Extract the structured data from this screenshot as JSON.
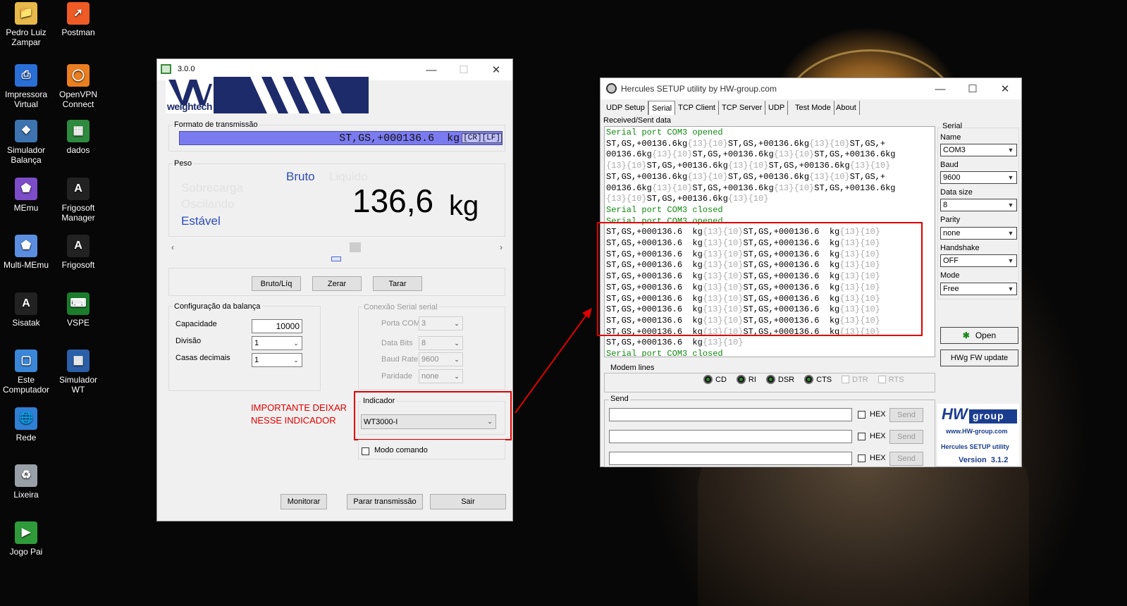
{
  "desktop": {
    "icons": [
      {
        "label": "Pedro Luiz Zampar",
        "icon": "folder-user-icon",
        "color": "#e8b84a"
      },
      {
        "label": "Postman",
        "icon": "postman-icon",
        "color": "#ef5b25"
      },
      {
        "label": "Impressora Virtual",
        "icon": "printer-icon",
        "color": "#2a6fd6"
      },
      {
        "label": "OpenVPN Connect",
        "icon": "openvpn-icon",
        "color": "#ea7e20"
      },
      {
        "label": "Simulador Balança",
        "icon": "python-icon",
        "color": "#3d74b0"
      },
      {
        "label": "dados",
        "icon": "spreadsheet-icon",
        "color": "#2e8a3e"
      },
      {
        "label": "MEmu",
        "icon": "memu-icon",
        "color": "#7d4cc9"
      },
      {
        "label": "Frigosoft Manager",
        "icon": "frigosoft-manager-icon",
        "color": "#222222"
      },
      {
        "label": "Multi-MEmu",
        "icon": "multi-memu-icon",
        "color": "#5b8ee0"
      },
      {
        "label": "Frigosoft",
        "icon": "frigosoft-icon",
        "color": "#222222"
      },
      {
        "label": "Sisatak",
        "icon": "sisatak-icon",
        "color": "#222222"
      },
      {
        "label": "VSPE",
        "icon": "vspe-icon",
        "color": "#1b7d2c"
      },
      {
        "label": "Este Computador",
        "icon": "computer-icon",
        "color": "#3a86d8"
      },
      {
        "label": "Simulador WT",
        "icon": "simulator-wt-icon",
        "color": "#2b5fa8"
      },
      {
        "label": "Rede",
        "icon": "network-icon",
        "color": "#2f7fd4"
      },
      {
        "label": "Lixeira",
        "icon": "recycle-bin-icon",
        "color": "#9aa0a8"
      },
      {
        "label": "Jogo Pai",
        "icon": "game-icon",
        "color": "#2f9a3a"
      }
    ]
  },
  "weightech": {
    "title": "3.0.0",
    "logo_text": "weightech",
    "formato_label": "Formato de transmissão",
    "formato_value": "ST,GS,+000136.6  kg",
    "formato_suffix": "[CR][LF]",
    "peso_label": "Peso",
    "bruto": "Bruto",
    "liquido": "Liquido",
    "sobrecarga": "Sobrecarga",
    "oscilando": "Oscilando",
    "estavel": "Estável",
    "weight_value": "136,6",
    "weight_unit": "kg",
    "btn_bruto_liq": "Bruto/Líq",
    "btn_zerar": "Zerar",
    "btn_tarar": "Tarar",
    "config_label": "Configuração da balança",
    "capacidade_label": "Capacidade",
    "capacidade_value": "10000",
    "divisao_label": "Divisão",
    "divisao_value": "1",
    "casas_label": "Casas decimais",
    "casas_value": "1",
    "conexao_label": "Conexão Serial serial",
    "porta_label": "Porta COM",
    "porta_value": "3",
    "databits_label": "Data Bits",
    "databits_value": "8",
    "baud_label": "Baud Rate",
    "baud_value": "9600",
    "paridade_label": "Paridade",
    "paridade_value": "none",
    "annotation_line1": "IMPORTANTE DEIXAR",
    "annotation_line2": "NESSE INDICADOR",
    "indicador_label": "Indicador",
    "indicador_value": "WT3000-I",
    "modo_comando": "Modo comando",
    "btn_monitorar": "Monitorar",
    "btn_parar": "Parar transmissão",
    "btn_sair": "Sair",
    "accent": "#e00000"
  },
  "hercules": {
    "title": "Hercules SETUP utility by HW-group.com",
    "tabs": [
      "UDP Setup",
      "Serial",
      "TCP Client",
      "TCP Server",
      "UDP",
      "Test Mode",
      "About"
    ],
    "received_label": "Received/Sent data",
    "serial_label": "Serial",
    "name_label": "Name",
    "name_value": "COM3",
    "baud_label": "Baud",
    "baud_value": "9600",
    "datasize_label": "Data size",
    "datasize_value": "8",
    "parity_label": "Parity",
    "parity_value": "none",
    "handshake_label": "Handshake",
    "handshake_value": "OFF",
    "mode_label": "Mode",
    "mode_value": "Free",
    "open_btn": "Open",
    "fw_btn": "HWg FW update",
    "modem_label": "Modem lines",
    "modem": [
      "CD",
      "RI",
      "DSR",
      "CTS",
      "DTR",
      "RTS"
    ],
    "send_label": "Send",
    "hex": "HEX",
    "send_btn": "Send",
    "brand_top": "HW",
    "brand_group": "group",
    "brand_url": "www.HW-group.com",
    "brand_name": "Hercules SETUP utility",
    "brand_version": "Version  3.1.2"
  }
}
